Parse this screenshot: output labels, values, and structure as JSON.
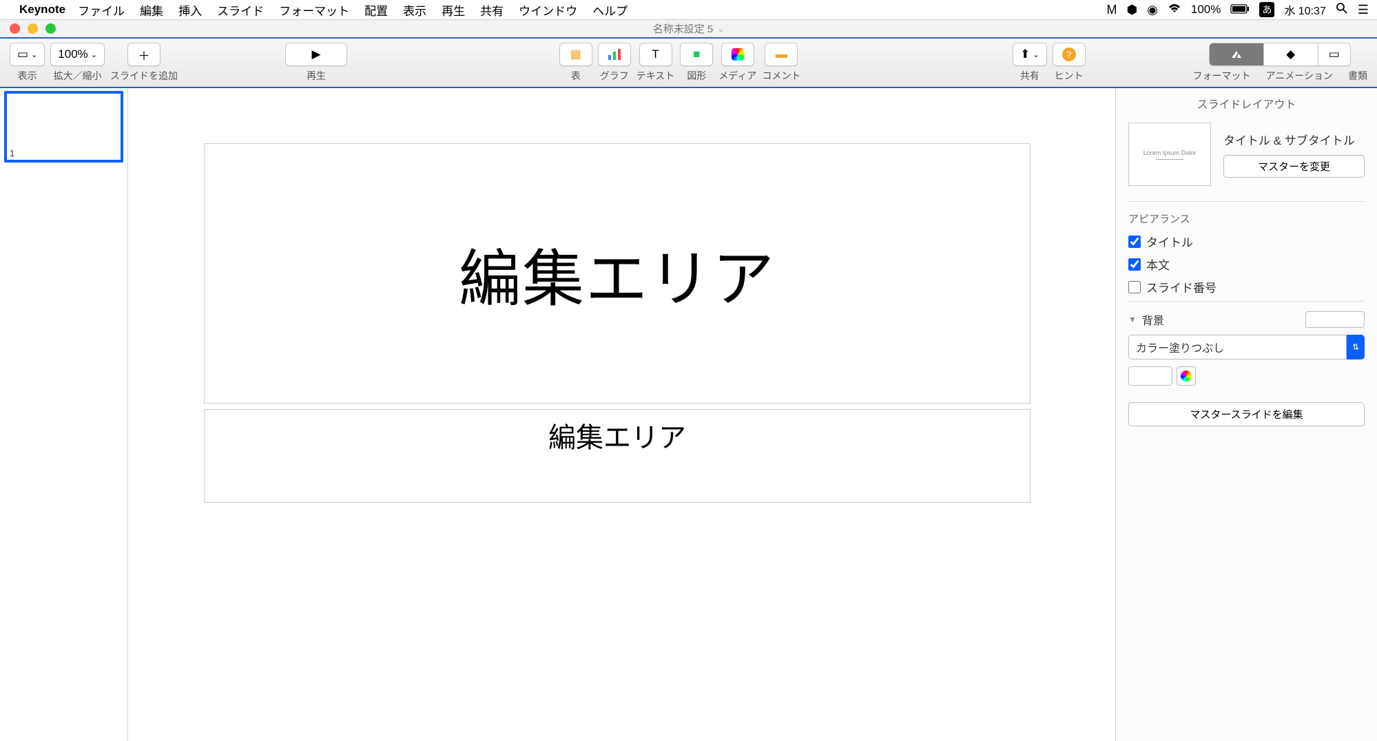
{
  "menubar": {
    "app": "Keynote",
    "items": [
      "ファイル",
      "編集",
      "挿入",
      "スライド",
      "フォーマット",
      "配置",
      "表示",
      "再生",
      "共有",
      "ウインドウ",
      "ヘルプ"
    ],
    "battery": "100%",
    "ime": "あ",
    "clock": "水 10:37"
  },
  "doc": {
    "title": "名称未設定 5"
  },
  "toolbar": {
    "view": "表示",
    "zoom_value": "100%",
    "zoom": "拡大／縮小",
    "add_slide": "スライドを追加",
    "play": "再生",
    "table": "表",
    "chart": "グラフ",
    "text": "テキスト",
    "shape": "図形",
    "media": "メディア",
    "comment": "コメント",
    "share": "共有",
    "hint": "ヒント",
    "format": "フォーマット",
    "animation": "アニメーション",
    "document": "書類"
  },
  "nav": {
    "slide1_num": "1"
  },
  "slide": {
    "title": "編集エリア",
    "subtitle": "編集エリア"
  },
  "inspector": {
    "header": "スライドレイアウト",
    "layout_sample": "Lorem Ipsum Dolor",
    "layout_name": "タイトル & サブタイトル",
    "change_master": "マスターを変更",
    "appearance": "アピアランス",
    "chk_title": "タイトル",
    "chk_body": "本文",
    "chk_slidenum": "スライド番号",
    "background": "背景",
    "fill_type": "カラー塗りつぶし",
    "edit_master": "マスタースライドを編集"
  }
}
